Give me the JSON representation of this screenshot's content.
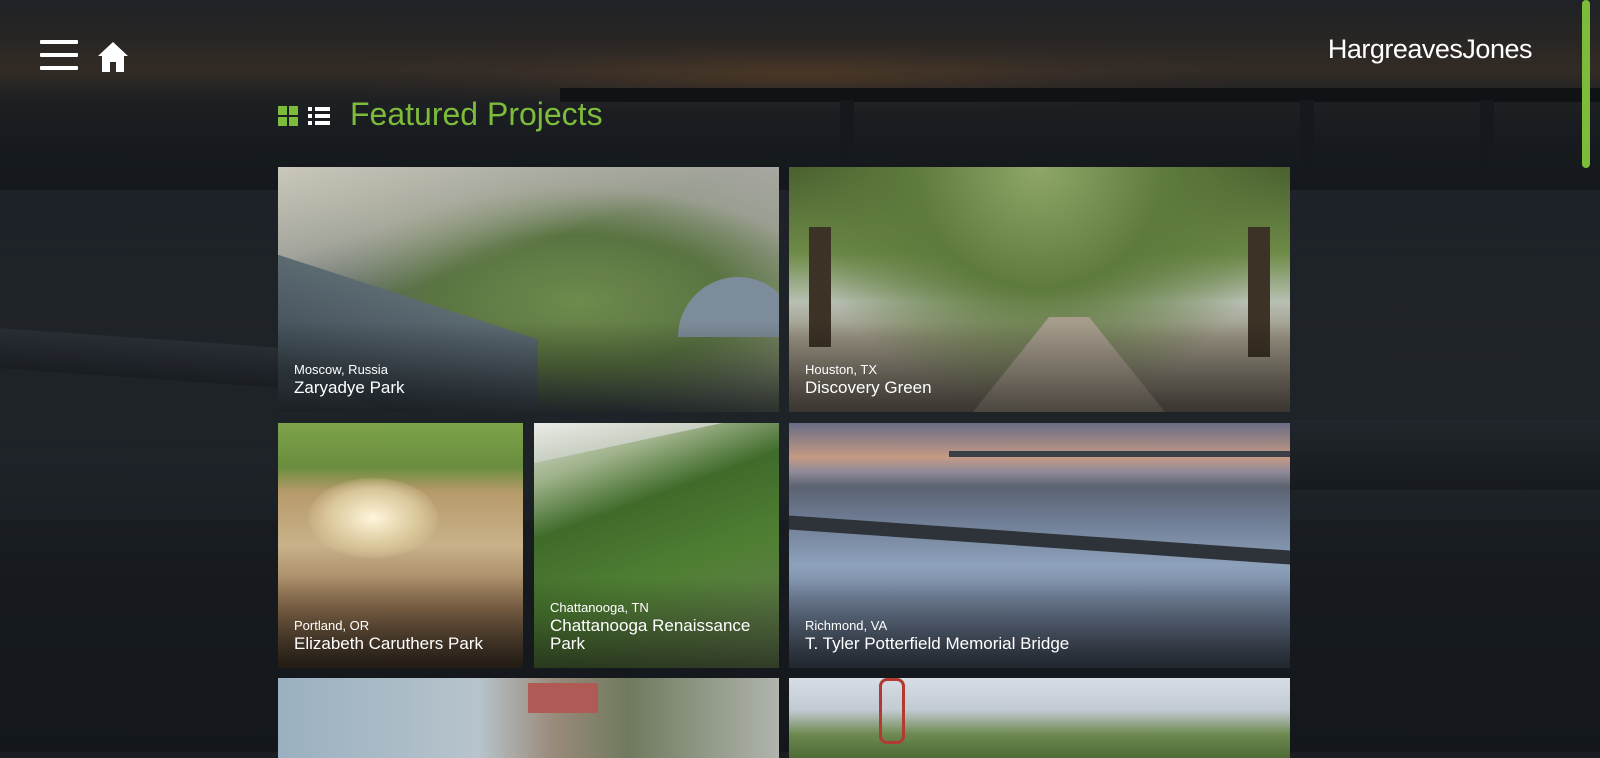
{
  "brand": {
    "logo_text": "HargreavesJones",
    "accent": "#7dbb3a"
  },
  "nav": {
    "menu_icon": "hamburger-menu-icon",
    "home_icon": "home-icon"
  },
  "section": {
    "title": "Featured Projects",
    "view_grid_icon": "grid-view-icon",
    "view_list_icon": "list-view-icon"
  },
  "projects": [
    {
      "location": "Moscow, Russia",
      "name": "Zaryadye Park"
    },
    {
      "location": "Houston, TX",
      "name": "Discovery Green"
    },
    {
      "location": "Portland, OR",
      "name": "Elizabeth Caruthers Park"
    },
    {
      "location": "Chattanooga, TN",
      "name": "Chattanooga Renaissance Park"
    },
    {
      "location": "Richmond, VA",
      "name": "T. Tyler Potterfield Memorial Bridge"
    }
  ]
}
